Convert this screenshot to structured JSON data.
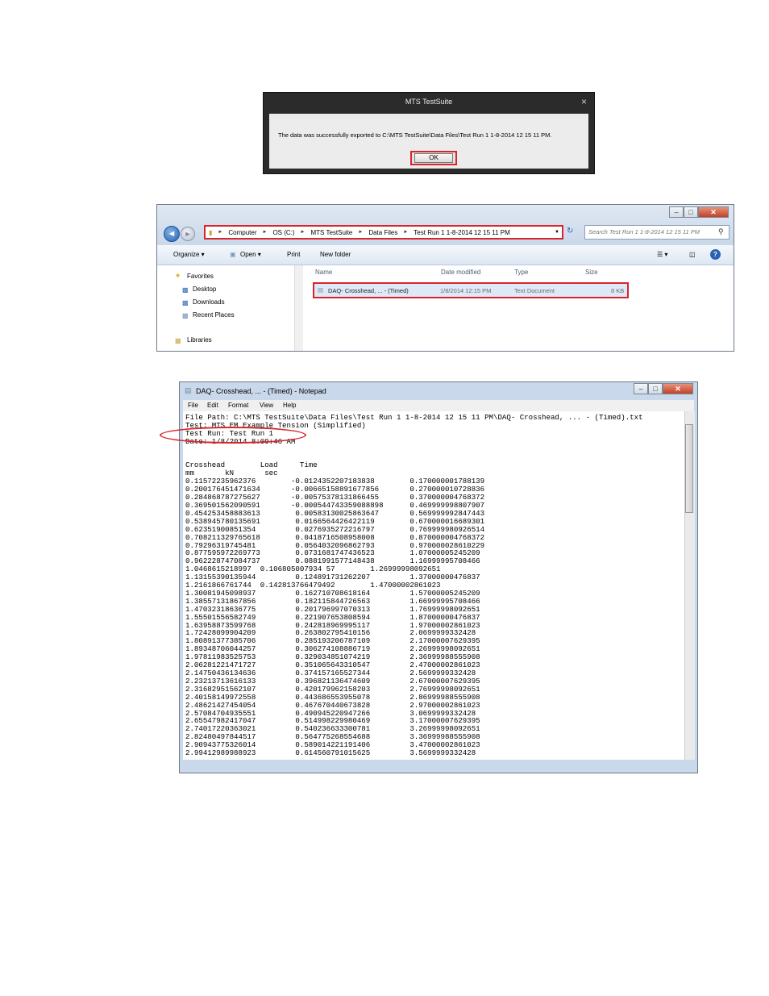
{
  "dialog": {
    "title": "MTS TestSuite",
    "close": "×",
    "message": "The data was successfully exported to C:\\MTS TestSuite\\Data Files\\Test Run 1 1-8-2014 12 15 11 PM.",
    "ok_label": "OK"
  },
  "explorer": {
    "window_buttons": {
      "minimize": "–",
      "maximize": "□",
      "close": "✕"
    },
    "back": "◄",
    "forward": "►",
    "breadcrumb": [
      "Computer",
      "OS (C:)",
      "MTS TestSuite",
      "Data Files",
      "Test Run 1 1-8-2014 12 15 11 PM"
    ],
    "search_placeholder": "Search Test Run 1 1-8-2014 12 15 11 PM",
    "toolbar": {
      "organize": "Organize ▾",
      "open": "Open ▾",
      "print": "Print",
      "new_folder": "New folder"
    },
    "nav": {
      "favorites": "Favorites",
      "desktop": "Desktop",
      "downloads": "Downloads",
      "recent": "Recent Places",
      "libraries": "Libraries"
    },
    "columns": {
      "name": "Name",
      "date": "Date modified",
      "type": "Type",
      "size": "Size"
    },
    "file": {
      "name": "DAQ- Crosshead, ... - (Timed)",
      "date": "1/8/2014 12:15 PM",
      "type": "Text Document",
      "size": "8 KB"
    }
  },
  "notepad": {
    "title": "DAQ- Crosshead, ... - (Timed) - Notepad",
    "menu": [
      "File",
      "Edit",
      "Format",
      "View",
      "Help"
    ],
    "lines": [
      "File Path: C:\\MTS TestSuite\\Data Files\\Test Run 1 1-8-2014 12 15 11 PM\\DAQ- Crosshead, ... - (Timed).txt",
      "Test: MTS EM Example Tension (Simplified)",
      "Test Run: Test Run 1",
      "Date: 1/8/2014 8:09:46 AM",
      "",
      "",
      "Crosshead        Load     Time",
      "mm       kN       sec",
      "0.11572235962376        -0.0124352207183838        0.170000001788139",
      "0.200176451471634       -0.00665158891677856       0.270000010728836",
      "0.284868787275627       -0.00575378131866455       0.370000004768372",
      "0.369501562090591       -0.000544743359088898      0.469999998807907",
      "0.454253458883613        0.00583130025863647       0.569999992847443",
      "0.538945780135691        0.0166564426422119        0.670000016689301",
      "0.62351900851354         0.0276935272216797        0.769999980926514",
      "0.708211329765618        0.0418716508958008        0.870000004768372",
      "0.79296319745481         0.0564032096862793        0.970000028610229",
      "0.877595972269773        0.0731681747436523        1.07000005245209",
      "0.962228747084737        0.0881991577148438        1.16999995708466",
      "1.0468615218997  0.106805007934 57        1.26999998092651",
      "1.13155390135944         0.124891731262207         1.37000000476837",
      "1.2161866761744  0.142813766479492        1.47000002861023",
      "1.30081945098937         0.162710708618164         1.57000005245209",
      "1.38557131867856         0.182115844726563         1.66999995708466",
      "1.47032318636775         0.201796997070313         1.76999998092651",
      "1.55501556582749         0.221907653808594         1.87000000476837",
      "1.63958873599768         0.242818969995117         1.97000002861023",
      "1.72428099904209         0.263802795410156         2.0699999332428",
      "1.80891377385706         0.285193206787109         2.17000007629395",
      "1.89348706044257         0.306274108886719         2.26999998092651",
      "1.97811983525753         0.329034851074219         2.36999988555908",
      "2.06281221471727         0.351065643310547         2.47000002861023",
      "2.14750436134636         0.374157165527344         2.5699999332428",
      "2.23213713616133         0.396821136474609         2.67000007629395",
      "2.31682951562107         0.420179962158203         2.76999998092651",
      "2.40158149972558         0.443686553955078         2.86999988555908",
      "2.48621427454054         0.467670440673828         2.97000002861023",
      "2.57084704935551         0.490945220947266         3.0699999332428",
      "2.65547982417047         0.514998229980469         3.17000007629395",
      "2.74017220363021         0.540236633300781         3.26999998092651",
      "2.82480497844517         0.564775268554688         3.36999988555908",
      "2.90943775326014         0.589014221191406         3.47000002861023",
      "2.99412989988923         0.614560791015625         3.5699999332428"
    ]
  },
  "colors": {
    "highlight": "#d8242a",
    "selection": "#dde9f7"
  }
}
